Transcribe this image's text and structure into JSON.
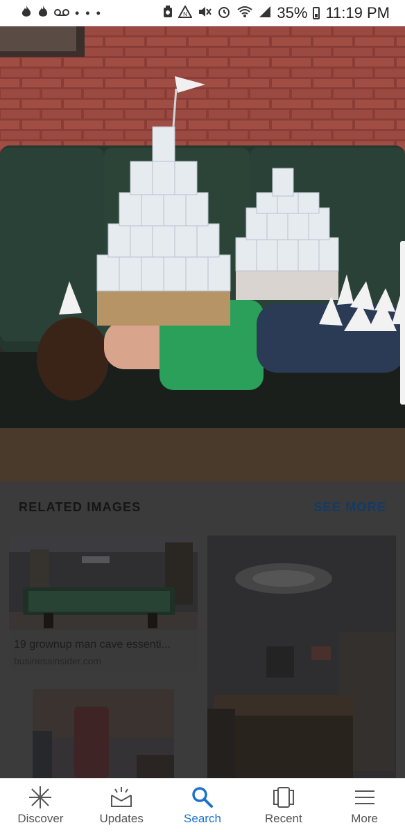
{
  "status_bar": {
    "left_icons": [
      "flame-icon",
      "flame-icon",
      "voicemail-icon"
    ],
    "more_dots": "• • •",
    "right_icons": [
      "recycle-icon",
      "nfc-icon",
      "mute-icon",
      "alarm-icon",
      "wifi-icon",
      "signal-icon"
    ],
    "battery": "35%",
    "time": "11:19 PM"
  },
  "related": {
    "title": "RELATED IMAGES",
    "see_more": "SEE MORE",
    "cards": [
      {
        "title": "19 grownup man cave essenti...",
        "source": "businessinsider.com"
      }
    ]
  },
  "bottom_nav": {
    "items": [
      {
        "label": "Discover",
        "icon": "asterisk-icon",
        "active": false
      },
      {
        "label": "Updates",
        "icon": "updates-icon",
        "active": false
      },
      {
        "label": "Search",
        "icon": "search-icon",
        "active": true
      },
      {
        "label": "Recent",
        "icon": "recent-cards-icon",
        "active": false
      },
      {
        "label": "More",
        "icon": "menu-icon",
        "active": false
      }
    ]
  },
  "colors": {
    "accent": "#1a73c9",
    "dim_overlay": "#3b3b3b",
    "see_more": "#143a66"
  }
}
